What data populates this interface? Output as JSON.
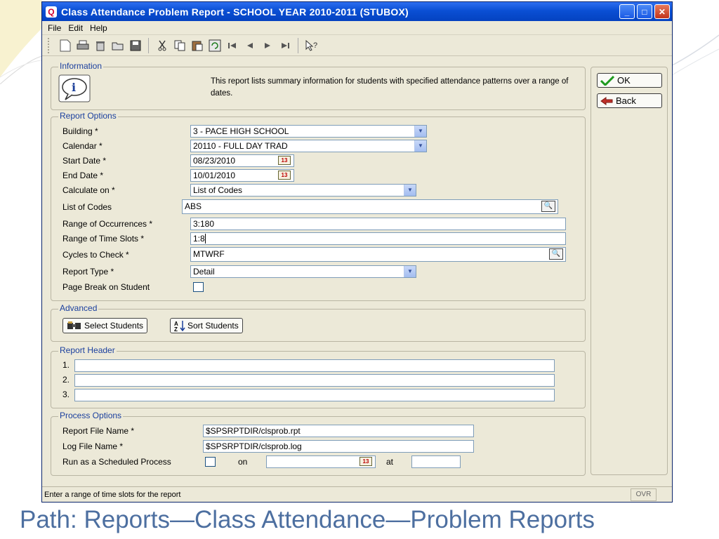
{
  "window": {
    "title": "Class Attendance Problem Report - SCHOOL YEAR 2010-2011  (STUBOX)",
    "app_icon": "Q",
    "minimize": "_",
    "maximize": "□",
    "close": "✕"
  },
  "menu": [
    "File",
    "Edit",
    "Help"
  ],
  "toolbar_icons": [
    "new-file",
    "print",
    "delete",
    "open",
    "save",
    "cut",
    "copy",
    "paste",
    "refresh",
    "first",
    "previous",
    "next",
    "last",
    "help-pointer"
  ],
  "information": {
    "legend": "Information",
    "text": "This report lists summary information for students with specified attendance patterns over a range of dates."
  },
  "report_options": {
    "legend": "Report Options",
    "building_label": "Building *",
    "building_value": "3 - PACE HIGH SCHOOL",
    "calendar_label": "Calendar *",
    "calendar_value": "20110 - FULL DAY TRAD",
    "start_label": "Start Date *",
    "start_value": "08/23/2010",
    "end_label": "End Date *",
    "end_value": "10/01/2010",
    "calc_label": "Calculate on *",
    "calc_value": "List of Codes",
    "codes_label": "List of Codes",
    "codes_value": "ABS",
    "occ_label": "Range of Occurrences *",
    "occ_value": "3:180",
    "slots_label": "Range of Time Slots *",
    "slots_value": "1:8",
    "cycles_label": "Cycles to Check *",
    "cycles_value": "MTWRF",
    "type_label": "Report Type *",
    "type_value": "Detail",
    "pagebreak_label": "Page Break on Student",
    "cal_icon_text": "13"
  },
  "advanced": {
    "legend": "Advanced",
    "select_students": "Select Students",
    "sort_students": "Sort Students"
  },
  "report_header": {
    "legend": "Report Header",
    "line1": "1.",
    "line2": "2.",
    "line3": "3."
  },
  "process_options": {
    "legend": "Process Options",
    "report_file_label": "Report File Name *",
    "report_file_value": "$SPSRPTDIR/clsprob.rpt",
    "log_file_label": "Log File Name *",
    "log_file_value": "$SPSRPTDIR/clsprob.log",
    "scheduled_label": "Run as a Scheduled Process",
    "on_label": "on",
    "at_label": "at"
  },
  "buttons": {
    "ok": "OK",
    "back": "Back"
  },
  "status": {
    "message": "Enter a range of time slots for the report",
    "mode": "OVR"
  },
  "caption": "Path: Reports—Class Attendance—Problem Reports",
  "colors": {
    "title_bar": "#0a4fd4",
    "caption": "#4d6fa0",
    "group_legend": "#1a3f9e"
  }
}
